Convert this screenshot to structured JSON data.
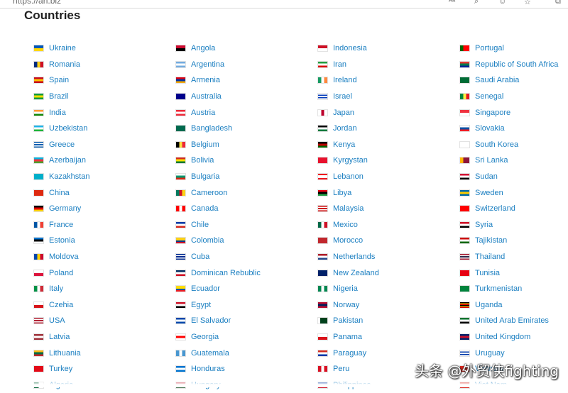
{
  "browser": {
    "url": "https://an.biz"
  },
  "heading": "Countries",
  "watermark": "头条 @外贸侠fighting",
  "columns": [
    [
      {
        "name": "Ukraine",
        "flag": [
          "#0057b7",
          "#ffd700"
        ],
        "dir": "h"
      },
      {
        "name": "Romania",
        "flag": [
          "#002b7f",
          "#fcd116",
          "#ce1126"
        ],
        "dir": "v"
      },
      {
        "name": "Spain",
        "flag": [
          "#c60b1e",
          "#ffc400",
          "#c60b1e"
        ],
        "dir": "h"
      },
      {
        "name": "Brazil",
        "flag": [
          "#009c3b",
          "#ffdf00",
          "#009c3b"
        ],
        "dir": "h"
      },
      {
        "name": "India",
        "flag": [
          "#ff9933",
          "#ffffff",
          "#138808"
        ],
        "dir": "h"
      },
      {
        "name": "Uzbekistan",
        "flag": [
          "#1eb5ea",
          "#ffffff",
          "#1eb53a"
        ],
        "dir": "h"
      },
      {
        "name": "Greece",
        "flag": [
          "#0d5eaf",
          "#ffffff",
          "#0d5eaf",
          "#ffffff",
          "#0d5eaf"
        ],
        "dir": "h"
      },
      {
        "name": "Azerbaijan",
        "flag": [
          "#00b5e2",
          "#ef3340",
          "#509e2f"
        ],
        "dir": "h"
      },
      {
        "name": "Kazakhstan",
        "flag": [
          "#00afca",
          "#00afca"
        ],
        "dir": "h"
      },
      {
        "name": "China",
        "flag": [
          "#de2910",
          "#de2910"
        ],
        "dir": "h"
      },
      {
        "name": "Germany",
        "flag": [
          "#000000",
          "#dd0000",
          "#ffce00"
        ],
        "dir": "h"
      },
      {
        "name": "France",
        "flag": [
          "#0055a4",
          "#ffffff",
          "#ef4135"
        ],
        "dir": "v"
      },
      {
        "name": "Estonia",
        "flag": [
          "#0072ce",
          "#000000",
          "#ffffff"
        ],
        "dir": "h"
      },
      {
        "name": "Moldova",
        "flag": [
          "#0046ae",
          "#ffd200",
          "#cc092f"
        ],
        "dir": "v"
      },
      {
        "name": "Poland",
        "flag": [
          "#ffffff",
          "#dc143c"
        ],
        "dir": "h"
      },
      {
        "name": "Italy",
        "flag": [
          "#009246",
          "#ffffff",
          "#ce2b37"
        ],
        "dir": "v"
      },
      {
        "name": "Czehia",
        "flag": [
          "#ffffff",
          "#d7141a"
        ],
        "dir": "h"
      },
      {
        "name": "USA",
        "flag": [
          "#b22234",
          "#ffffff",
          "#b22234",
          "#ffffff",
          "#b22234"
        ],
        "dir": "h"
      },
      {
        "name": "Latvia",
        "flag": [
          "#9e3039",
          "#ffffff",
          "#9e3039"
        ],
        "dir": "h"
      },
      {
        "name": "Lithuania",
        "flag": [
          "#fdb913",
          "#006a44",
          "#c1272d"
        ],
        "dir": "h"
      },
      {
        "name": "Turkey",
        "flag": [
          "#e30a17",
          "#e30a17"
        ],
        "dir": "h"
      },
      {
        "name": "Algeria",
        "flag": [
          "#006233",
          "#ffffff"
        ],
        "dir": "v"
      }
    ],
    [
      {
        "name": "Angola",
        "flag": [
          "#cc092f",
          "#000000"
        ],
        "dir": "h"
      },
      {
        "name": "Argentina",
        "flag": [
          "#74acdf",
          "#ffffff",
          "#74acdf"
        ],
        "dir": "h"
      },
      {
        "name": "Armenia",
        "flag": [
          "#d90012",
          "#0033a0",
          "#f2a800"
        ],
        "dir": "h"
      },
      {
        "name": "Australia",
        "flag": [
          "#00008b",
          "#00008b"
        ],
        "dir": "h"
      },
      {
        "name": "Austria",
        "flag": [
          "#ed2939",
          "#ffffff",
          "#ed2939"
        ],
        "dir": "h"
      },
      {
        "name": "Bangladesh",
        "flag": [
          "#006a4e",
          "#006a4e"
        ],
        "dir": "h"
      },
      {
        "name": "Belgium",
        "flag": [
          "#000000",
          "#fae042",
          "#ed2939"
        ],
        "dir": "v"
      },
      {
        "name": "Bolivia",
        "flag": [
          "#d52b1e",
          "#f9e300",
          "#007934"
        ],
        "dir": "h"
      },
      {
        "name": "Bulgaria",
        "flag": [
          "#ffffff",
          "#00966e",
          "#d62612"
        ],
        "dir": "h"
      },
      {
        "name": "Cameroon",
        "flag": [
          "#007a5e",
          "#ce1126",
          "#fcd116"
        ],
        "dir": "v"
      },
      {
        "name": "Canada",
        "flag": [
          "#ff0000",
          "#ffffff",
          "#ff0000"
        ],
        "dir": "v"
      },
      {
        "name": "Chile",
        "flag": [
          "#0039a6",
          "#ffffff",
          "#d52b1e"
        ],
        "dir": "h"
      },
      {
        "name": "Colombia",
        "flag": [
          "#fcd116",
          "#fcd116",
          "#003893",
          "#ce1126"
        ],
        "dir": "h"
      },
      {
        "name": "Cuba",
        "flag": [
          "#002a8f",
          "#ffffff",
          "#002a8f",
          "#ffffff",
          "#002a8f"
        ],
        "dir": "h"
      },
      {
        "name": "Dominican Rebublic",
        "flag": [
          "#002d62",
          "#ffffff",
          "#ce1126"
        ],
        "dir": "h"
      },
      {
        "name": "Ecuador",
        "flag": [
          "#ffdd00",
          "#ffdd00",
          "#034ea2",
          "#ed1c24"
        ],
        "dir": "h"
      },
      {
        "name": "Egypt",
        "flag": [
          "#ce1126",
          "#ffffff",
          "#000000"
        ],
        "dir": "h"
      },
      {
        "name": "El Salvador",
        "flag": [
          "#0047ab",
          "#ffffff",
          "#0047ab"
        ],
        "dir": "h"
      },
      {
        "name": "Georgia",
        "flag": [
          "#ffffff",
          "#ff0000",
          "#ffffff"
        ],
        "dir": "h"
      },
      {
        "name": "Guatemala",
        "flag": [
          "#4997d0",
          "#ffffff",
          "#4997d0"
        ],
        "dir": "v"
      },
      {
        "name": "Honduras",
        "flag": [
          "#0073cf",
          "#ffffff",
          "#0073cf"
        ],
        "dir": "h"
      },
      {
        "name": "Hungary",
        "flag": [
          "#cd2a3e",
          "#ffffff",
          "#436f4d"
        ],
        "dir": "h"
      }
    ],
    [
      {
        "name": "Indonesia",
        "flag": [
          "#ce1126",
          "#ffffff"
        ],
        "dir": "h"
      },
      {
        "name": "Iran",
        "flag": [
          "#239f40",
          "#ffffff",
          "#da0000"
        ],
        "dir": "h"
      },
      {
        "name": "Ireland",
        "flag": [
          "#169b62",
          "#ffffff",
          "#ff883e"
        ],
        "dir": "v"
      },
      {
        "name": "Israel",
        "flag": [
          "#ffffff",
          "#0038b8",
          "#ffffff",
          "#0038b8",
          "#ffffff"
        ],
        "dir": "h"
      },
      {
        "name": "Japan",
        "flag": [
          "#ffffff",
          "#bc002d",
          "#ffffff"
        ],
        "dir": "v"
      },
      {
        "name": "Jordan",
        "flag": [
          "#000000",
          "#ffffff",
          "#007a3d"
        ],
        "dir": "h"
      },
      {
        "name": "Kenya",
        "flag": [
          "#000000",
          "#bb0000",
          "#006600"
        ],
        "dir": "h"
      },
      {
        "name": "Kyrgystan",
        "flag": [
          "#e8112d",
          "#e8112d"
        ],
        "dir": "h"
      },
      {
        "name": "Lebanon",
        "flag": [
          "#ee161f",
          "#ffffff",
          "#ffffff",
          "#ee161f"
        ],
        "dir": "h"
      },
      {
        "name": "Libya",
        "flag": [
          "#e70013",
          "#000000",
          "#239e46"
        ],
        "dir": "h"
      },
      {
        "name": "Malaysia",
        "flag": [
          "#cc0001",
          "#ffffff",
          "#cc0001",
          "#ffffff",
          "#cc0001"
        ],
        "dir": "h"
      },
      {
        "name": "Mexico",
        "flag": [
          "#006847",
          "#ffffff",
          "#ce1126"
        ],
        "dir": "v"
      },
      {
        "name": "Morocco",
        "flag": [
          "#c1272d",
          "#c1272d"
        ],
        "dir": "h"
      },
      {
        "name": "Netherlands",
        "flag": [
          "#ae1c28",
          "#ffffff",
          "#21468b"
        ],
        "dir": "h"
      },
      {
        "name": "New Zealand",
        "flag": [
          "#012169",
          "#012169"
        ],
        "dir": "h"
      },
      {
        "name": "Nigeria",
        "flag": [
          "#008751",
          "#ffffff",
          "#008751"
        ],
        "dir": "v"
      },
      {
        "name": "Norway",
        "flag": [
          "#ba0c2f",
          "#00205b",
          "#ba0c2f"
        ],
        "dir": "h"
      },
      {
        "name": "Pakistan",
        "flag": [
          "#ffffff",
          "#01411c",
          "#01411c",
          "#01411c"
        ],
        "dir": "v"
      },
      {
        "name": "Panama",
        "flag": [
          "#ffffff",
          "#da121a"
        ],
        "dir": "h"
      },
      {
        "name": "Paraguay",
        "flag": [
          "#d52b1e",
          "#ffffff",
          "#0038a8"
        ],
        "dir": "h"
      },
      {
        "name": "Peru",
        "flag": [
          "#d91023",
          "#ffffff",
          "#d91023"
        ],
        "dir": "v"
      },
      {
        "name": "Philippines",
        "flag": [
          "#0038a8",
          "#ce1126"
        ],
        "dir": "h"
      }
    ],
    [
      {
        "name": "Portugal",
        "flag": [
          "#006600",
          "#ff0000",
          "#ff0000"
        ],
        "dir": "v"
      },
      {
        "name": "Republic of South Africa",
        "flag": [
          "#de3831",
          "#007a4d",
          "#002395"
        ],
        "dir": "h"
      },
      {
        "name": "Saudi Arabia",
        "flag": [
          "#006c35",
          "#006c35"
        ],
        "dir": "h"
      },
      {
        "name": "Senegal",
        "flag": [
          "#00853f",
          "#fdef42",
          "#e31b23"
        ],
        "dir": "v"
      },
      {
        "name": "Singapore",
        "flag": [
          "#ef3340",
          "#ffffff"
        ],
        "dir": "h"
      },
      {
        "name": "Slovakia",
        "flag": [
          "#ffffff",
          "#0b4ea2",
          "#ee1c25"
        ],
        "dir": "h"
      },
      {
        "name": "South Korea",
        "flag": [
          "#ffffff",
          "#ffffff"
        ],
        "dir": "h"
      },
      {
        "name": "Sri Lanka",
        "flag": [
          "#ffb700",
          "#8d153a",
          "#8d153a"
        ],
        "dir": "v"
      },
      {
        "name": "Sudan",
        "flag": [
          "#d21034",
          "#ffffff",
          "#000000"
        ],
        "dir": "h"
      },
      {
        "name": "Sweden",
        "flag": [
          "#006aa7",
          "#fecc00",
          "#006aa7"
        ],
        "dir": "h"
      },
      {
        "name": "Switzerland",
        "flag": [
          "#ff0000",
          "#ff0000"
        ],
        "dir": "h"
      },
      {
        "name": "Syria",
        "flag": [
          "#ce1126",
          "#ffffff",
          "#000000"
        ],
        "dir": "h"
      },
      {
        "name": "Tajikistan",
        "flag": [
          "#cc0000",
          "#ffffff",
          "#006600"
        ],
        "dir": "h"
      },
      {
        "name": "Thailand",
        "flag": [
          "#a51931",
          "#f4f5f8",
          "#2d2a4a",
          "#f4f5f8",
          "#a51931"
        ],
        "dir": "h"
      },
      {
        "name": "Tunisia",
        "flag": [
          "#e70013",
          "#e70013"
        ],
        "dir": "h"
      },
      {
        "name": "Turkmenistan",
        "flag": [
          "#00843d",
          "#00843d"
        ],
        "dir": "h"
      },
      {
        "name": "Uganda",
        "flag": [
          "#000000",
          "#fcdc04",
          "#d90000",
          "#000000",
          "#fcdc04",
          "#d90000"
        ],
        "dir": "h"
      },
      {
        "name": "United Arab Emirates",
        "flag": [
          "#00732f",
          "#ffffff",
          "#000000"
        ],
        "dir": "h"
      },
      {
        "name": "United Kingdom",
        "flag": [
          "#012169",
          "#c8102e",
          "#012169"
        ],
        "dir": "h"
      },
      {
        "name": "Uruguay",
        "flag": [
          "#ffffff",
          "#0038a8",
          "#ffffff",
          "#0038a8",
          "#ffffff"
        ],
        "dir": "h"
      },
      {
        "name": "Vietnam",
        "flag": [
          "#da251d",
          "#da251d"
        ],
        "dir": "h"
      },
      {
        "name": "Viet Nam",
        "flag": [
          "#da251d",
          "#da251d"
        ],
        "dir": "h"
      }
    ]
  ]
}
